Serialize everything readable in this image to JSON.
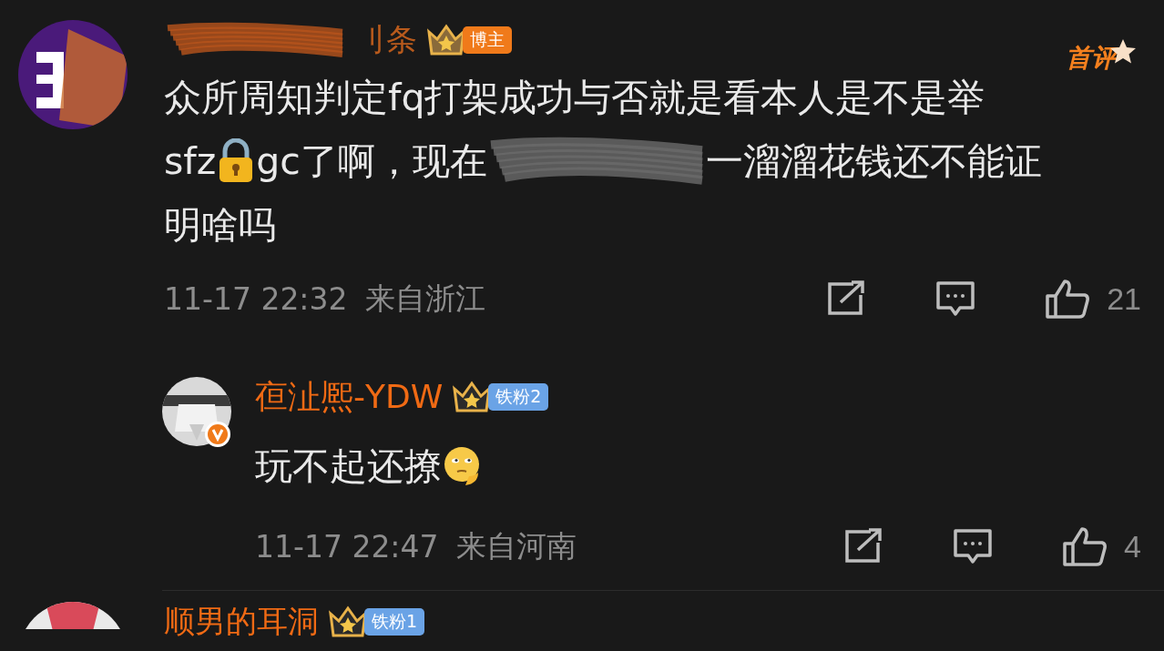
{
  "comments": [
    {
      "kind": "top",
      "author": "刂条",
      "author_redacted": true,
      "badge": {
        "kind": "blogger",
        "label": "博主"
      },
      "first_comment": "首评",
      "body": [
        [
          {
            "kind": "text",
            "text": "众所周知判定fq打架成功与否就是看本人是不是举"
          }
        ],
        [
          {
            "kind": "text",
            "text": "sfz"
          },
          {
            "kind": "lock"
          },
          {
            "kind": "text",
            "text": "gc了啊，现在"
          },
          {
            "kind": "redacted"
          },
          {
            "kind": "text",
            "text": "一溜溜花钱还不能证"
          }
        ],
        [
          {
            "kind": "text",
            "text": "明啥吗"
          }
        ]
      ],
      "time": "11-17 22:32",
      "location": "来自浙江",
      "likes": "21"
    },
    {
      "kind": "reply",
      "author": "亱沚熈-YDW",
      "verified": true,
      "badge": {
        "kind": "fan",
        "label": "铁粉2"
      },
      "body": [
        [
          {
            "kind": "text",
            "text": "玩不起还撩"
          },
          {
            "kind": "thinking"
          }
        ]
      ],
      "time": "11-17 22:47",
      "location": "来自河南",
      "likes": "4"
    },
    {
      "kind": "top",
      "author": "顺男的耳洞",
      "badge": {
        "kind": "fan",
        "label": "铁粉1"
      }
    }
  ]
}
